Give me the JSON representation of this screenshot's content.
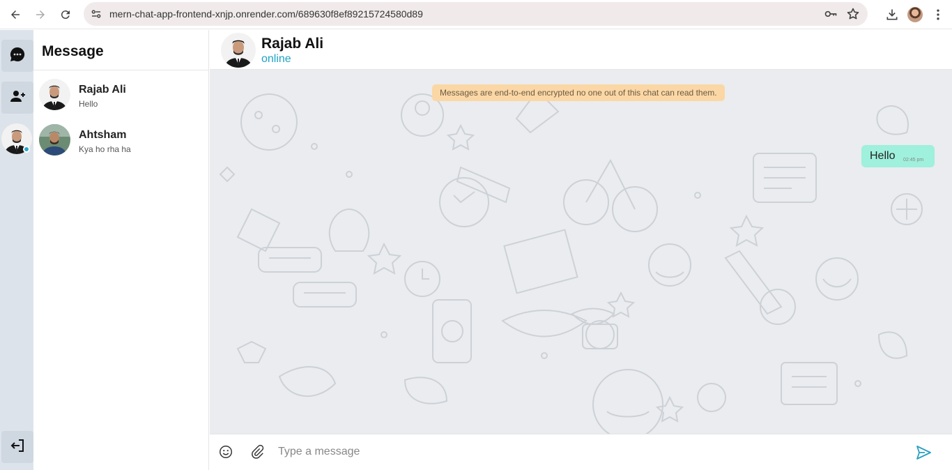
{
  "browser": {
    "url": "mern-chat-app-frontend-xnjp.onrender.com/689630f8ef89215724580d89",
    "icons": [
      "back-icon",
      "forward-icon",
      "reload-icon",
      "site-info-icon",
      "password-key-icon",
      "star-icon",
      "download-icon",
      "profile-avatar",
      "more-vert-icon"
    ]
  },
  "rail": {
    "icons": [
      "chat-bubble-icon",
      "add-user-icon",
      "user-avatar",
      "logout-icon"
    ],
    "online_color": "#27a9c9"
  },
  "sidebar": {
    "title": "Message",
    "contacts": [
      {
        "name": "Rajab Ali",
        "last_message": "Hello"
      },
      {
        "name": "Ahtsham",
        "last_message": "Kya ho rha ha"
      }
    ]
  },
  "chat": {
    "contact_name": "Rajab Ali",
    "status": "online",
    "status_color": "#20a3c3",
    "encryption_notice": "Messages are end-to-end encrypted no one out of this chat can read them.",
    "messages": [
      {
        "text": "Hello",
        "time": "02:45 pm",
        "sent": true
      }
    ],
    "bubble_color": "#9ff0dd",
    "composer": {
      "placeholder": "Type a message",
      "value": ""
    }
  }
}
